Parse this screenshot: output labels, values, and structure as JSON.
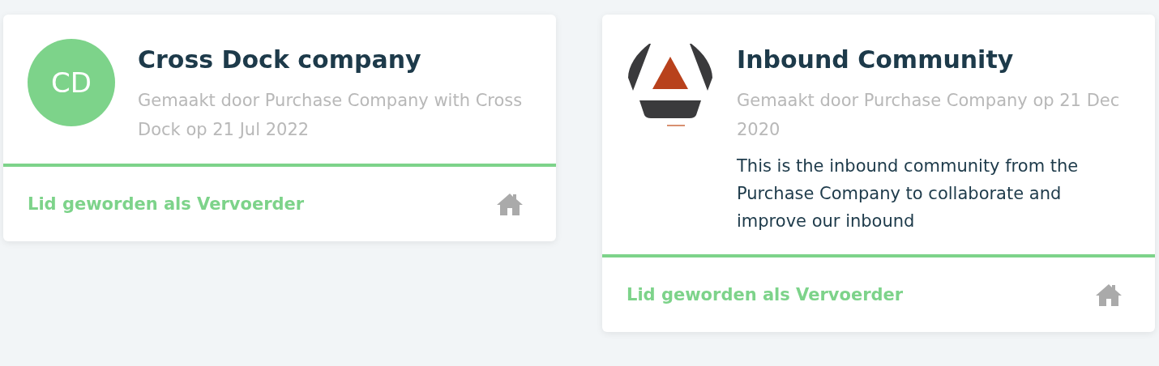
{
  "communities": [
    {
      "name": "Cross Dock company",
      "avatar": {
        "kind": "initials",
        "text": "CD"
      },
      "meta": "Gemaakt door Purchase Company with Cross Dock op 21 Jul 2022",
      "membership": "Lid geworden als Vervoerder"
    },
    {
      "name": "Inbound Community",
      "avatar": {
        "kind": "logo"
      },
      "meta": "Gemaakt door Purchase Company op 21 Dec 2020",
      "description": "This is the inbound community from the Purchase Company to collaborate and improve our inbound",
      "membership": "Lid geworden als Vervoerder"
    }
  ]
}
